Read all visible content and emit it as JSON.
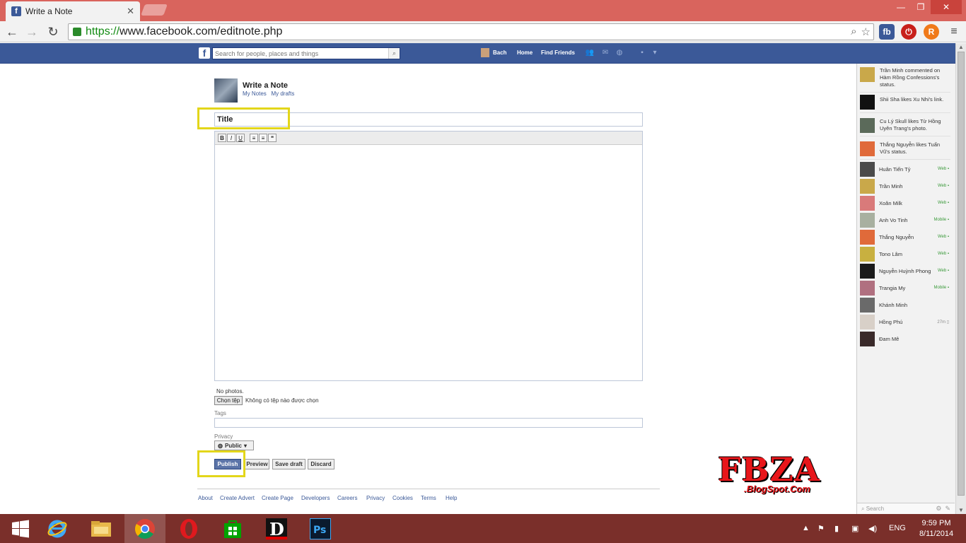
{
  "browser": {
    "tab_title": "Write a Note",
    "tab_close": "✕",
    "url_scheme": "https://",
    "url_rest": "www.facebook.com/editnote.php",
    "ext_fb": "fb",
    "ext_red": "⏻",
    "ext_orange": "R",
    "menu": "≡"
  },
  "fbheader": {
    "search_placeholder": "Search for people, places and things",
    "user": "Bach",
    "home": "Home",
    "find_friends": "Find Friends"
  },
  "note": {
    "heading": "Write a Note",
    "my_notes": "My Notes",
    "my_drafts": "My drafts",
    "title_placeholder": "Title",
    "toolbar": {
      "bold": "B",
      "italic": "I",
      "underline": "U",
      "ol": "≡",
      "ul": "≡",
      "quote": "❝"
    },
    "no_photos": "No photos.",
    "choose_file": "Chọn tệp",
    "no_file": "Không có tệp nào được chọn",
    "tags_label": "Tags",
    "privacy_label": "Privacy",
    "privacy_value": "Public",
    "publish": "Publish",
    "preview": "Preview",
    "save_draft": "Save draft",
    "discard": "Discard"
  },
  "footer": [
    "About",
    "Create Advert",
    "Create Page",
    "Developers",
    "Careers",
    "Privacy",
    "Cookies",
    "Terms",
    "Help"
  ],
  "watermark": {
    "main": "FBZA",
    "sub": ".BlogSpot.Com"
  },
  "ticker": [
    {
      "text": "Trần Minh commented on Hàm Rồng Confessions's status."
    },
    {
      "text": "Shii Sha likes Xu Nhi's link."
    },
    {
      "text": "Cu Lý Skull likes Từ Hồng Uyên Trang's photo."
    },
    {
      "text": "Thắng Nguyễn likes Tuấn Vũ's status."
    }
  ],
  "chat": [
    {
      "name": "Huân Tiến Tỷ",
      "status": "Web ▪"
    },
    {
      "name": "Trần Minh",
      "status": "Web ▪"
    },
    {
      "name": "Xoăn Milk",
      "status": "Web ▪"
    },
    {
      "name": "Anh Vo Tinh",
      "status": "Mobile ▪"
    },
    {
      "name": "Thắng Nguyễn",
      "status": "Web ▪"
    },
    {
      "name": "Tono Lâm",
      "status": "Web ▪"
    },
    {
      "name": "Nguyễn Huỳnh Phong",
      "status": "Web ▪"
    },
    {
      "name": "Trangia My",
      "status": "Mobile ▪"
    },
    {
      "name": "Khánh Minh",
      "status": ""
    },
    {
      "name": "Hồng Phú",
      "status": "27m ▯"
    },
    {
      "name": "Đam Mê",
      "status": ""
    }
  ],
  "chat_search": "Search",
  "taskbar": {
    "lang": "ENG",
    "time": "9:59 PM",
    "date": "8/11/2014"
  }
}
